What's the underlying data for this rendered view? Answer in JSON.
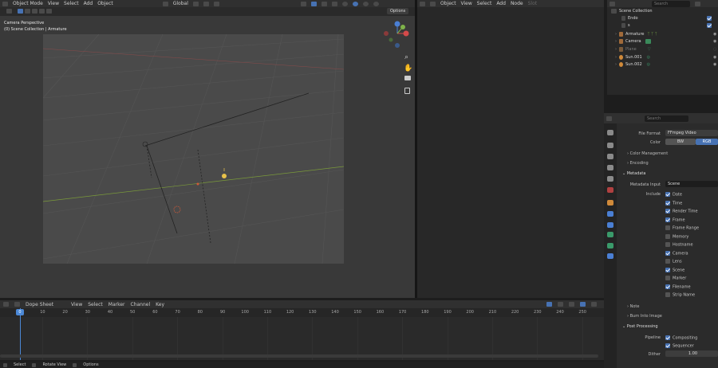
{
  "viewport_header": {
    "mode": "Object Mode",
    "menus": [
      "View",
      "Select",
      "Add",
      "Object"
    ],
    "orientation": "Global",
    "options": "Options"
  },
  "viewport": {
    "title": "Camera Perspective",
    "subtitle": "(0) Scene Collection | Armature"
  },
  "mid_header": {
    "mode": "Object",
    "menus": [
      "View",
      "Select",
      "Add",
      "Node"
    ],
    "slot": "Slot"
  },
  "outliner": {
    "search_placeholder": "Search",
    "root": "Scene Collection",
    "items": [
      {
        "name": "Endo",
        "dim": false
      },
      {
        "name": "s",
        "dim": false
      },
      {
        "name": "Armature",
        "dim": false
      },
      {
        "name": "Camera",
        "dim": false
      },
      {
        "name": "Plane",
        "dim": true
      },
      {
        "name": "Sun.001",
        "dim": false
      },
      {
        "name": "Sun.002",
        "dim": false
      }
    ]
  },
  "properties": {
    "search_placeholder": "Search",
    "file_format_label": "File Format",
    "file_format_value": "FFmpeg Video",
    "color_label": "Color",
    "color_options": [
      "BW",
      "RGB"
    ],
    "panels": {
      "color_management": "Color Management",
      "encoding": "Encoding",
      "metadata": "Metadata",
      "note": "Note",
      "burn_into_image": "Burn Into Image",
      "post_processing": "Post Processing"
    },
    "metadata_input_label": "Metadata Input",
    "metadata_input_value": "Scene",
    "include_label": "Include",
    "include": [
      {
        "label": "Date",
        "on": true
      },
      {
        "label": "Time",
        "on": true
      },
      {
        "label": "Render Time",
        "on": true
      },
      {
        "label": "Frame",
        "on": true
      },
      {
        "label": "Frame Range",
        "on": false
      },
      {
        "label": "Memory",
        "on": false
      },
      {
        "label": "Hostname",
        "on": false
      },
      {
        "label": "Camera",
        "on": true
      },
      {
        "label": "Lens",
        "on": false
      },
      {
        "label": "Scene",
        "on": true
      },
      {
        "label": "Marker",
        "on": false
      },
      {
        "label": "Filename",
        "on": true
      },
      {
        "label": "Strip Name",
        "on": false
      }
    ],
    "pipeline_label": "Pipeline",
    "pipeline": [
      {
        "label": "Compositing",
        "on": true
      },
      {
        "label": "Sequencer",
        "on": true
      }
    ],
    "dither_label": "Dither",
    "dither_value": "1.00"
  },
  "timeline": {
    "editor": "Dope Sheet",
    "menus": [
      "View",
      "Select",
      "Marker",
      "Channel",
      "Key"
    ],
    "current_frame": "0",
    "ticks": [
      "10",
      "20",
      "30",
      "40",
      "50",
      "60",
      "70",
      "80",
      "90",
      "100",
      "110",
      "120",
      "130",
      "140",
      "150",
      "160",
      "170",
      "180",
      "190",
      "200",
      "210",
      "220",
      "230",
      "240",
      "250"
    ]
  },
  "status": {
    "items": [
      "Select",
      "Rotate View",
      "Options"
    ]
  },
  "colors": {
    "accent": "#4772b3",
    "playhead": "#4b88d6",
    "axis_x": "#d44a4a",
    "axis_y": "#7fb34a",
    "axis_z": "#4a7fd4"
  }
}
